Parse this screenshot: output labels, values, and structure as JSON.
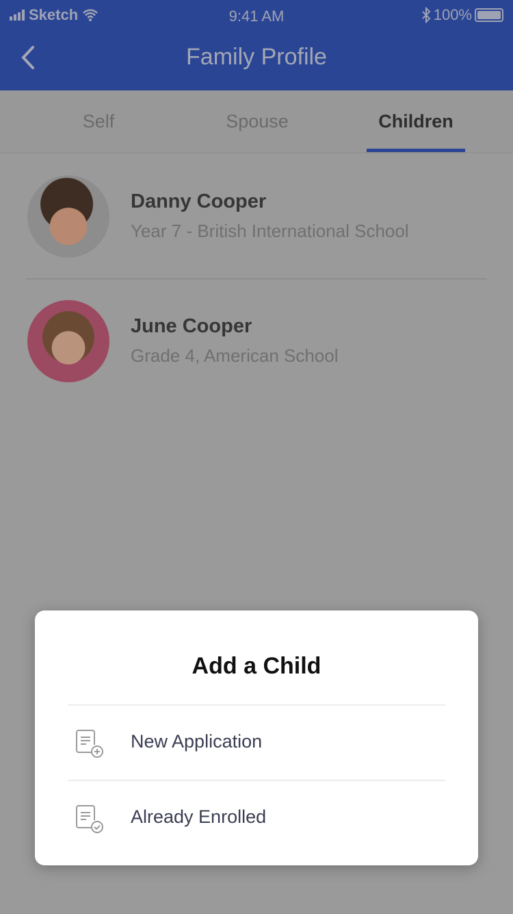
{
  "status_bar": {
    "carrier": "Sketch",
    "time": "9:41 AM",
    "battery": "100%"
  },
  "header": {
    "title": "Family Profile"
  },
  "tabs": [
    {
      "label": "Self"
    },
    {
      "label": "Spouse"
    },
    {
      "label": "Children",
      "active": true
    }
  ],
  "children": [
    {
      "name": "Danny Cooper",
      "detail": "Year 7  -  British International School"
    },
    {
      "name": "June Cooper",
      "detail": "Grade 4, American School"
    }
  ],
  "modal": {
    "title": "Add a Child",
    "options": [
      {
        "label": "New Application",
        "icon": "document-plus-icon"
      },
      {
        "label": "Already Enrolled",
        "icon": "document-check-icon"
      }
    ]
  },
  "colors": {
    "brand": "#2b4595"
  }
}
